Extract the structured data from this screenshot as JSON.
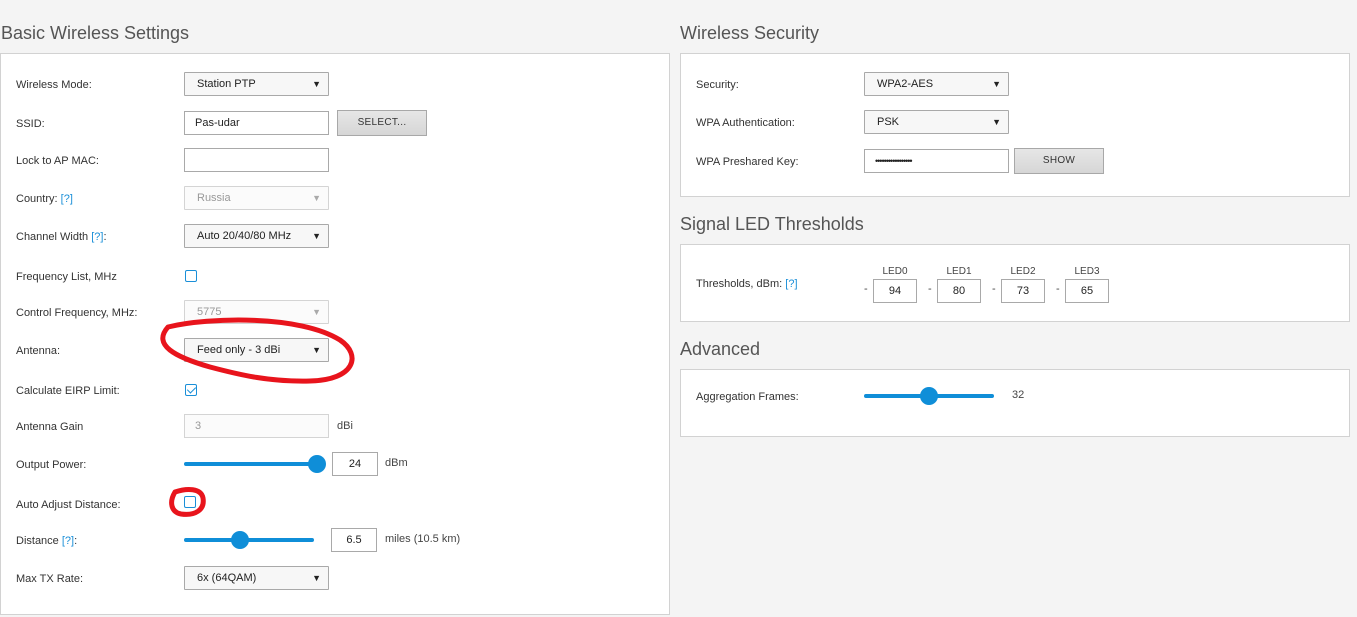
{
  "basic": {
    "title": "Basic Wireless Settings",
    "wireless_mode": {
      "label": "Wireless Mode:",
      "value": "Station PTP"
    },
    "ssid": {
      "label": "SSID:",
      "value": "Pas-udar",
      "button": "SELECT..."
    },
    "lock_mac": {
      "label": "Lock to AP MAC:",
      "value": ""
    },
    "country": {
      "label": "Country:",
      "help": "[?]",
      "value": "Russia"
    },
    "channel_width": {
      "label": "Channel Width",
      "help": "[?]",
      "suffix": ":",
      "value": "Auto 20/40/80 MHz"
    },
    "freq_list": {
      "label": "Frequency List, MHz",
      "checked": false
    },
    "control_freq": {
      "label": "Control Frequency, MHz:",
      "value": "5775"
    },
    "antenna": {
      "label": "Antenna:",
      "value": "Feed only - 3 dBi"
    },
    "calc_eirp": {
      "label": "Calculate EIRP Limit:",
      "checked": true
    },
    "antenna_gain": {
      "label": "Antenna Gain",
      "value": "3",
      "unit": "dBi"
    },
    "output_power": {
      "label": "Output Power:",
      "value": "24",
      "unit": "dBm",
      "slider_fraction": 1.0
    },
    "auto_distance": {
      "label": "Auto Adjust Distance:",
      "checked": false
    },
    "distance": {
      "label": "Distance",
      "help": "[?]",
      "suffix": ":",
      "value": "6.5",
      "unit": "miles (10.5 km)",
      "slider_fraction": 0.42
    },
    "max_tx": {
      "label": "Max TX Rate:",
      "value": "6x (64QAM)"
    }
  },
  "security": {
    "title": "Wireless Security",
    "security": {
      "label": "Security:",
      "value": "WPA2-AES"
    },
    "wpa_auth": {
      "label": "WPA Authentication:",
      "value": "PSK"
    },
    "psk": {
      "label": "WPA Preshared Key:",
      "value": "•••••••••••••••••",
      "button": "SHOW"
    }
  },
  "led": {
    "title": "Signal LED Thresholds",
    "label": "Thresholds, dBm:",
    "help": "[?]",
    "dash": "-",
    "items": [
      {
        "name": "LED0",
        "value": "94"
      },
      {
        "name": "LED1",
        "value": "80"
      },
      {
        "name": "LED2",
        "value": "73"
      },
      {
        "name": "LED3",
        "value": "65"
      }
    ]
  },
  "advanced": {
    "title": "Advanced",
    "aggregation": {
      "label": "Aggregation Frames:",
      "value": "32",
      "slider_fraction": 0.5
    }
  },
  "colors": {
    "accent": "#0f8ed8",
    "annotation": "#e8141c"
  }
}
